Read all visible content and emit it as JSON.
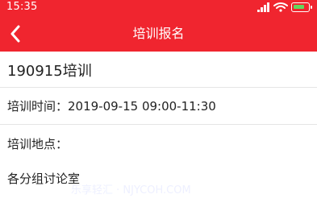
{
  "status_bar": {
    "time": "15:35",
    "icons": [
      "signal-icon",
      "wifi-icon",
      "battery-icon"
    ]
  },
  "header": {
    "back_icon": "chevron-left-icon",
    "title": "培训报名",
    "background_color": "#f0252f"
  },
  "training": {
    "name": "190915培训",
    "time": "培训时间：2019-09-15 09:00-11:30",
    "location_label": "培训地点：",
    "location_value": "各分组讨论室"
  },
  "watermark": {
    "text": "乐享轻汇 · NJYCOH.COM"
  }
}
